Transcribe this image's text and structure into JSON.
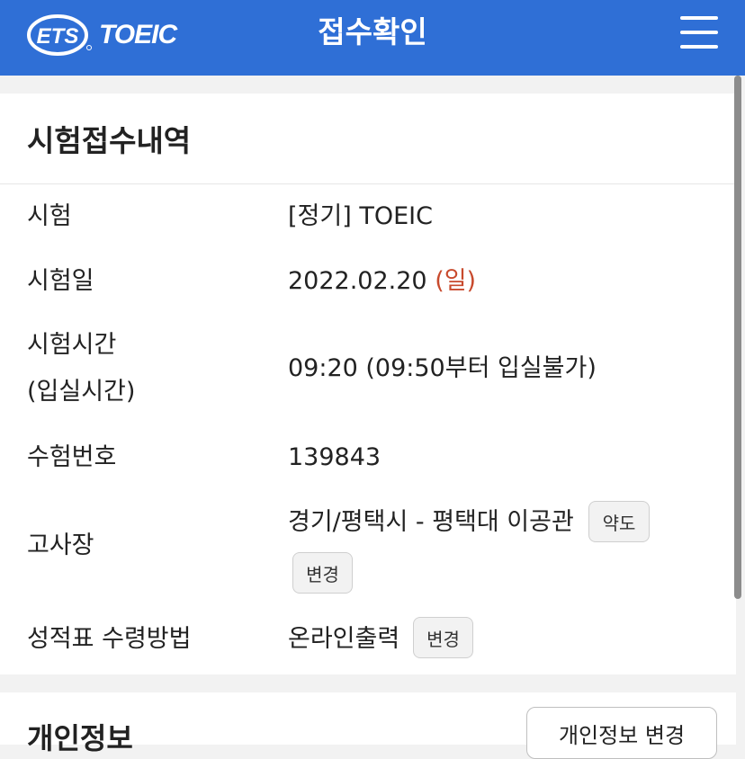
{
  "header": {
    "logo_text": "TOEIC",
    "logo_badge_text": "ETS",
    "title": "접수확인",
    "menu_icon": "hamburger-menu-icon",
    "background_color": "#2f6fd6"
  },
  "registration": {
    "section_title": "시험접수내역",
    "rows": [
      {
        "label": "시험",
        "value": "[정기] TOEIC"
      },
      {
        "label": "시험일",
        "value": "2022.02.20",
        "day": "(일)"
      },
      {
        "label_line1": "시험시간",
        "label_line2": "(입실시간)",
        "value": "09:20 (09:50부터 입실불가)"
      },
      {
        "label": "수험번호",
        "value": "139843"
      },
      {
        "label": "고사장",
        "value": "경기/평택시 - 평택대 이공관",
        "map_button": "약도",
        "change_button": "변경"
      },
      {
        "label": "성적표 수령방법",
        "value": "온라인출력",
        "change_button": "변경"
      }
    ],
    "day_color": "#c84a2d"
  },
  "personal_info": {
    "section_title": "개인정보",
    "edit_button": "개인정보 변경"
  }
}
